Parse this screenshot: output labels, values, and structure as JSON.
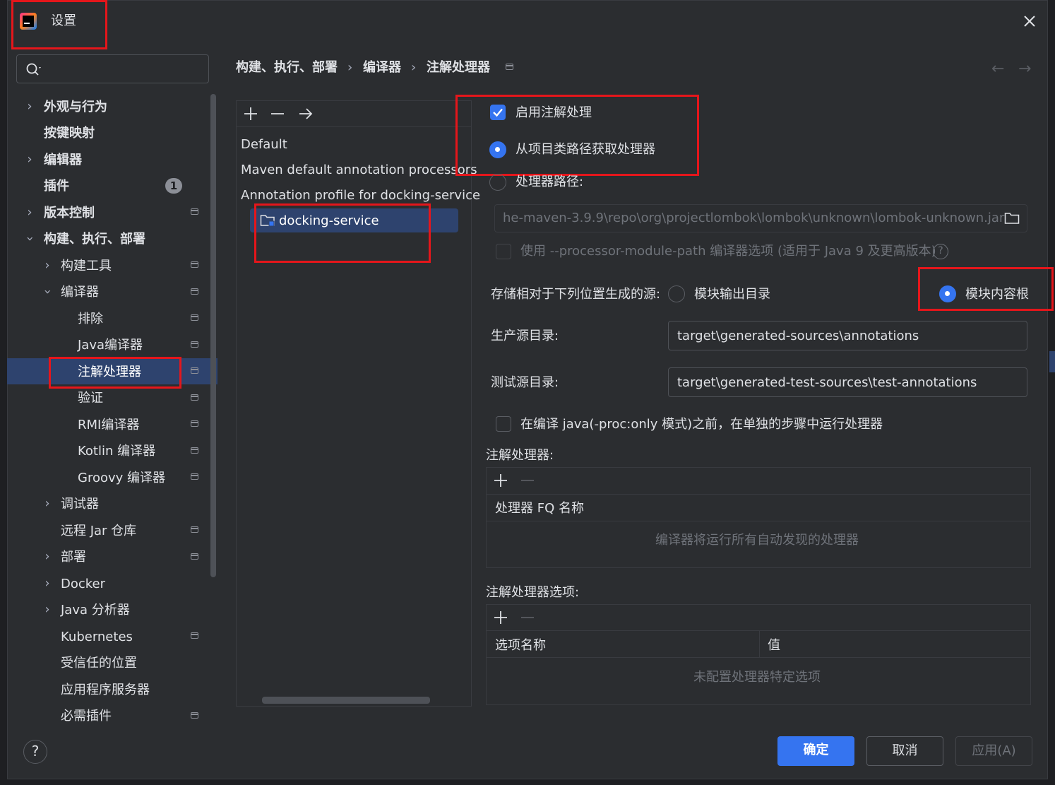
{
  "window": {
    "title": "设置"
  },
  "search": {
    "placeholder": ""
  },
  "breadcrumb": {
    "items": [
      "构建、执行、部署",
      "编译器",
      "注解处理器"
    ]
  },
  "sidebar": {
    "items": [
      {
        "label": "外观与行为"
      },
      {
        "label": "按键映射"
      },
      {
        "label": "编辑器"
      },
      {
        "label": "插件",
        "badge": "1"
      },
      {
        "label": "版本控制"
      },
      {
        "label": "构建、执行、部署"
      },
      {
        "label": "构建工具"
      },
      {
        "label": "编译器"
      },
      {
        "label": "排除"
      },
      {
        "label": "Java编译器"
      },
      {
        "label": "注解处理器"
      },
      {
        "label": "验证"
      },
      {
        "label": "RMI编译器"
      },
      {
        "label": "Kotlin 编译器"
      },
      {
        "label": "Groovy 编译器"
      },
      {
        "label": "调试器"
      },
      {
        "label": "远程 Jar 仓库"
      },
      {
        "label": "部署"
      },
      {
        "label": "Docker"
      },
      {
        "label": "Java 分析器"
      },
      {
        "label": "Kubernetes"
      },
      {
        "label": "受信任的位置"
      },
      {
        "label": "应用程序服务器"
      },
      {
        "label": "必需插件"
      }
    ]
  },
  "profiles": {
    "items": [
      "Default",
      "Maven default annotation processors",
      "Annotation profile for docking-service",
      "docking-service"
    ]
  },
  "settings": {
    "enable_label": "启用注解处理",
    "from_classpath_label": "从项目类路径获取处理器",
    "processor_path_label": "处理器路径:",
    "processor_path_value": "he-maven-3.9.9\\repo\\org\\projectlombok\\lombok\\unknown\\lombok-unknown.jar",
    "module_path_label": "使用 --processor-module-path 编译器选项 (适用于 Java 9 及更高版本)",
    "store_label": "存储相对于下列位置生成的源:",
    "module_output_label": "模块输出目录",
    "module_content_root_label": "模块内容根",
    "prod_dir_label": "生产源目录:",
    "prod_dir_value": "target\\generated-sources\\annotations",
    "test_dir_label": "测试源目录:",
    "test_dir_value": "target\\generated-test-sources\\test-annotations",
    "separate_step_label": "在编译 java(-proc:only 模式)之前，在单独的步骤中运行处理器",
    "processors_title": "注解处理器:",
    "processors_column": "处理器 FQ 名称",
    "processors_empty": "编译器将运行所有自动发现的处理器",
    "options_title": "注解处理器选项:",
    "options_col_name": "选项名称",
    "options_col_value": "值",
    "options_empty": "未配置处理器特定选项"
  },
  "footer": {
    "ok": "确定",
    "cancel": "取消",
    "apply": "应用(A)"
  },
  "colors": {
    "accent": "#3574f0",
    "highlight": "#e5161b",
    "selection": "#2e436e"
  }
}
